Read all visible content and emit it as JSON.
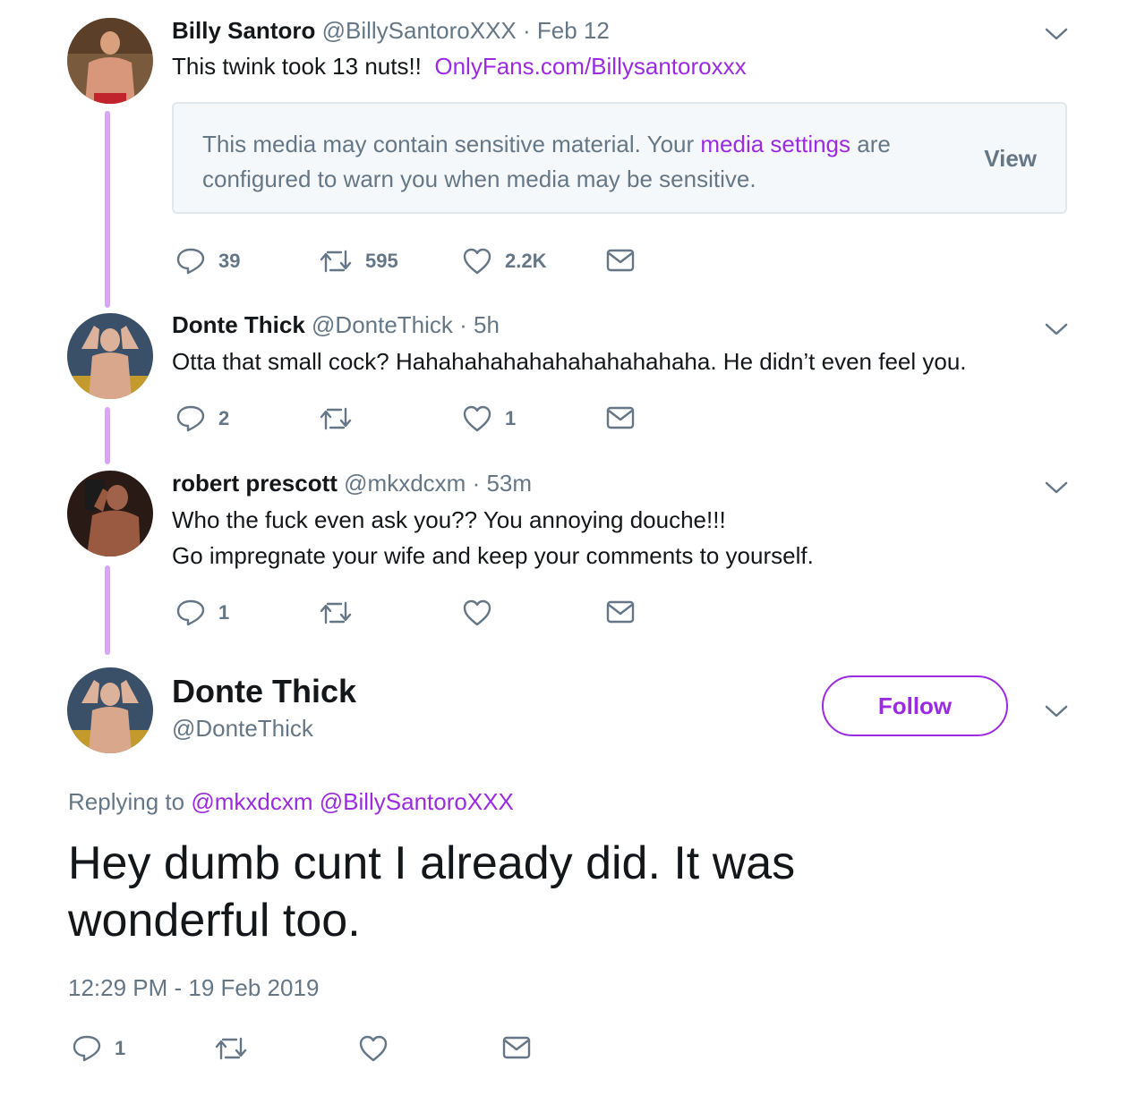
{
  "colors": {
    "accent": "#9b2be0",
    "thread_line": "#d7a6f5",
    "muted": "#657786"
  },
  "tweets": [
    {
      "name": "Billy Santoro",
      "handle": "@BillySantoroXXX",
      "time": "· Feb 12",
      "text": "This twink took 13 nuts!!",
      "link": "OnlyFans.com/Billysantoroxxx",
      "media_warning": {
        "text_before": "This media may contain sensitive material. Your ",
        "link": "media settings",
        "text_after": " are configured to warn you when media may be sensitive.",
        "button": "View"
      },
      "replies": "39",
      "retweets": "595",
      "likes": "2.2K"
    },
    {
      "name": "Donte Thick",
      "handle": "@DonteThick",
      "time": "· 5h",
      "text": "Otta that small cock? Hahahahahahahahahahahaha. He didn’t even feel you.",
      "replies": "2",
      "retweets": "",
      "likes": "1"
    },
    {
      "name": "robert prescott",
      "handle": "@mkxdcxm",
      "time": "· 53m",
      "text_line1": "Who the fuck even ask you?? You annoying douche!!!",
      "text_line2": "Go impregnate your wife and keep your comments to yourself.",
      "replies": "1",
      "retweets": "",
      "likes": ""
    }
  ],
  "main_tweet": {
    "name": "Donte Thick",
    "handle": "@DonteThick",
    "follow_label": "Follow",
    "replying_prefix": "Replying to",
    "replying_to_1": "@mkxdcxm",
    "replying_to_2": "@BillySantoroXXX",
    "text_line1": "Hey dumb cunt I already did. It was",
    "text_line2": "wonderful too.",
    "timestamp": "12:29 PM - 19 Feb 2019",
    "replies": "1"
  },
  "icons": [
    "reply-icon",
    "retweet-icon",
    "like-icon",
    "dm-icon",
    "chevron-down-icon"
  ]
}
